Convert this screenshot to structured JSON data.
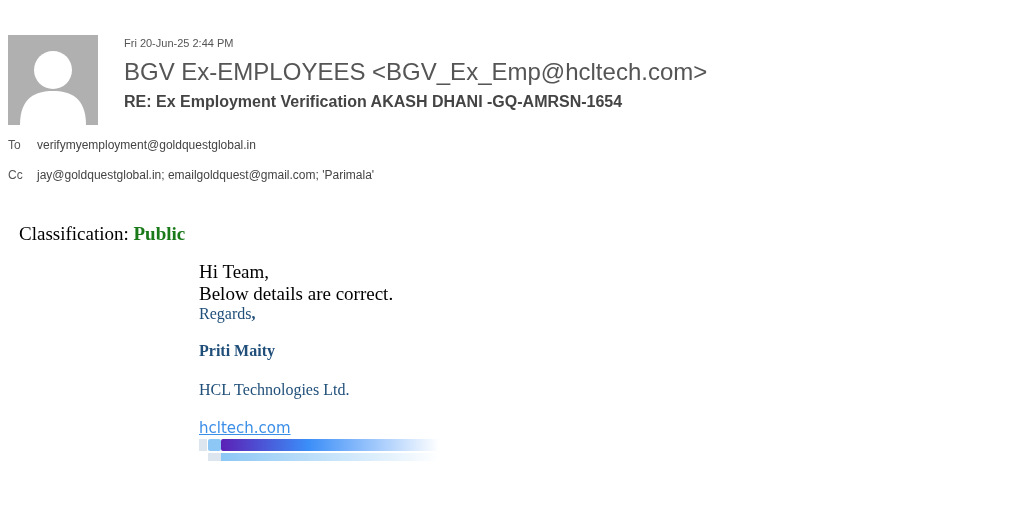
{
  "header": {
    "date": "Fri 20-Jun-25 2:44 PM",
    "sender": "BGV Ex-EMPLOYEES <BGV_Ex_Emp@hcltech.com>",
    "subject": "RE: Ex Employment Verification AKASH DHANI -GQ-AMRSN-1654",
    "recipients": [
      {
        "label": "To",
        "value": "verifymyemployment@goldquestglobal.in"
      },
      {
        "label": "Cc",
        "value": "jay@goldquestglobal.in; emailgoldquest@gmail.com; 'Parimala'"
      }
    ]
  },
  "body": {
    "classification": "Classification: **Public**",
    "greeting": [
      "Hi Team,",
      "Below details are correct."
    ],
    "signature": {
      "closing": "Regards**,**",
      "name": "Priti Maity",
      "company": "HCL Technologies Ltd.",
      "link": "hcltech.com"
    }
  }
}
